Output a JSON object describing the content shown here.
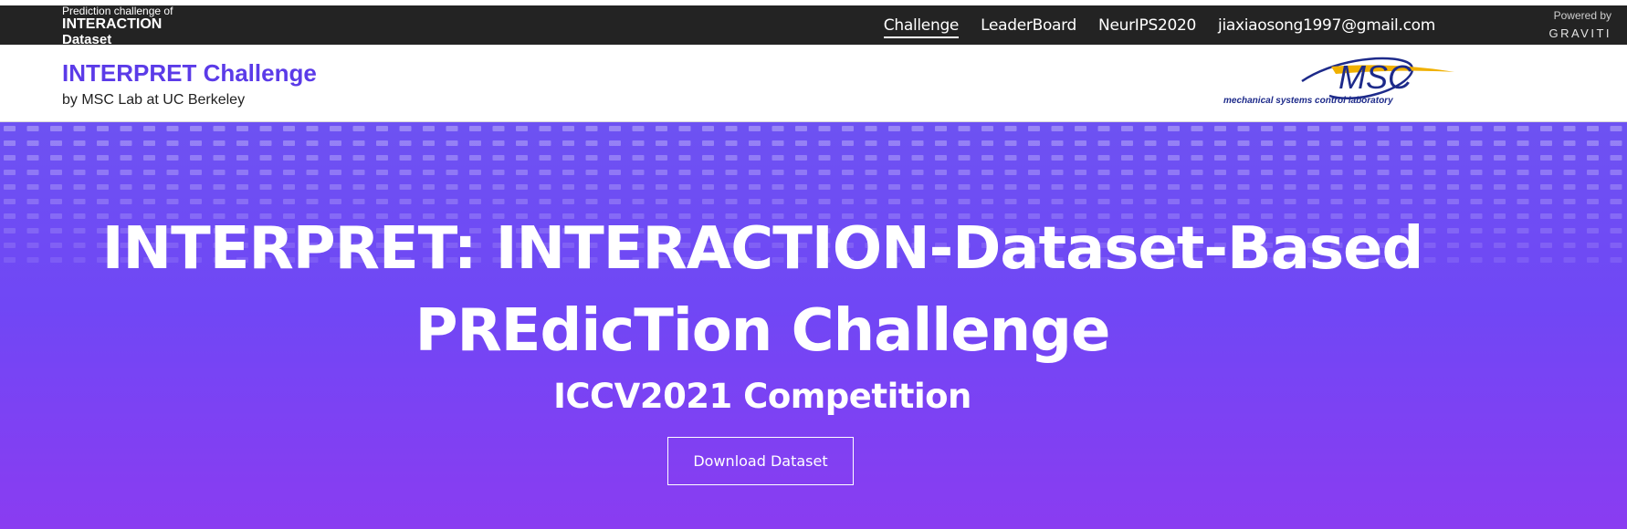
{
  "topbar": {
    "brand_line1": "Prediction challenge of",
    "brand_line2": "INTERACTION",
    "brand_line3": "Dataset",
    "nav": [
      "Challenge",
      "LeaderBoard",
      "NeurIPS2020",
      "jiaxiaosong1997@gmail.com"
    ],
    "active_nav": "Challenge",
    "powered_label": "Powered by",
    "powered_brand": "GRAVITI"
  },
  "header": {
    "title": "INTERPRET Challenge",
    "subtitle": "by MSC Lab at UC Berkeley",
    "logo_text": "MSC",
    "logo_caption": "mechanical systems control laboratory",
    "logo_color": "#1d2a8a",
    "logo_swoosh_color": "#f0b000"
  },
  "hero": {
    "title_line1": "INTERPRET: INTERACTION-Dataset-Based",
    "title_line2": "PREdicTion Challenge",
    "subtitle": "ICCV2021 Competition",
    "button_label": "Download Dataset",
    "gradient_top": "#6d52f2",
    "gradient_bottom": "#8a3cf1"
  },
  "colors": {
    "topbar_bg": "#232323",
    "title_purple": "#5b3be8"
  }
}
